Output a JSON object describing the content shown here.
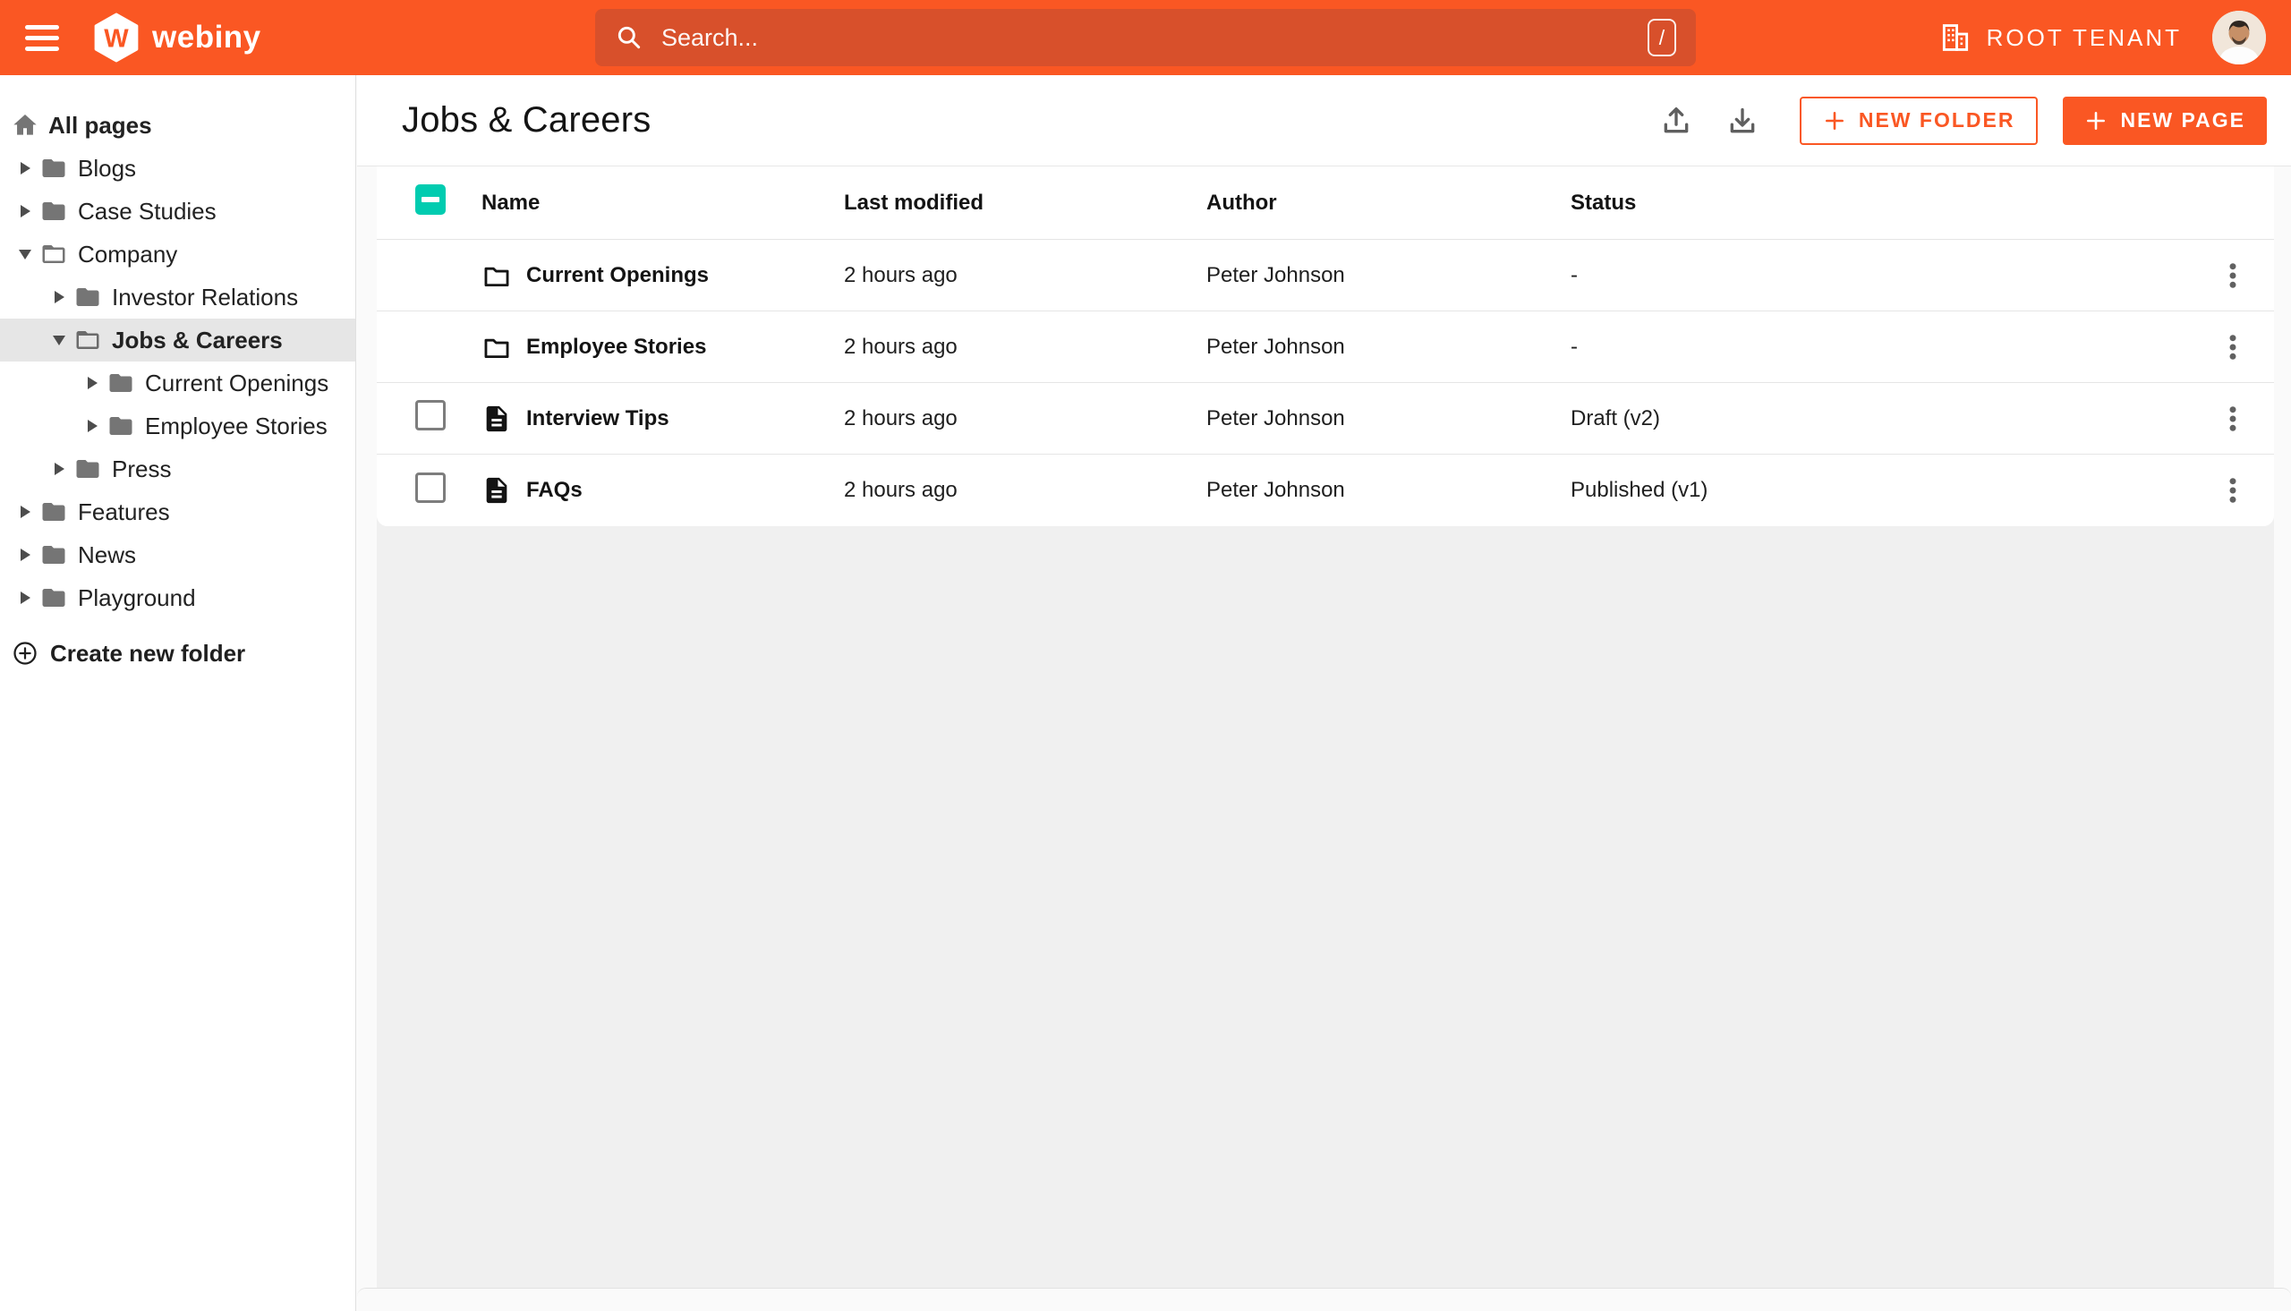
{
  "topbar": {
    "logo_text": "webiny",
    "search": {
      "placeholder": "Search...",
      "shortcut_key": "/"
    },
    "tenant_label": "ROOT TENANT"
  },
  "sidebar": {
    "root_label": "All pages",
    "items": [
      {
        "label": "Blogs",
        "level": 1,
        "state": "collapsed"
      },
      {
        "label": "Case Studies",
        "level": 1,
        "state": "collapsed"
      },
      {
        "label": "Company",
        "level": 1,
        "state": "expanded"
      },
      {
        "label": "Investor Relations",
        "level": 2,
        "state": "collapsed"
      },
      {
        "label": "Jobs & Careers",
        "level": 2,
        "state": "expanded",
        "selected": true
      },
      {
        "label": "Current Openings",
        "level": 3,
        "state": "collapsed"
      },
      {
        "label": "Employee Stories",
        "level": 3,
        "state": "collapsed"
      },
      {
        "label": "Press",
        "level": 2,
        "state": "collapsed"
      },
      {
        "label": "Features",
        "level": 1,
        "state": "collapsed"
      },
      {
        "label": "News",
        "level": 1,
        "state": "collapsed"
      },
      {
        "label": "Playground",
        "level": 1,
        "state": "collapsed"
      }
    ],
    "create_folder_label": "Create new folder"
  },
  "page": {
    "title": "Jobs & Careers",
    "actions": {
      "new_folder": "NEW FOLDER",
      "new_page": "NEW PAGE"
    }
  },
  "table": {
    "select_all_state": "indeterminate",
    "columns": [
      "Name",
      "Last modified",
      "Author",
      "Status"
    ],
    "rows": [
      {
        "type": "folder",
        "name": "Current Openings",
        "modified": "2 hours ago",
        "author": "Peter Johnson",
        "status": "-"
      },
      {
        "type": "folder",
        "name": "Employee Stories",
        "modified": "2 hours ago",
        "author": "Peter Johnson",
        "status": "-"
      },
      {
        "type": "page",
        "name": "Interview Tips",
        "modified": "2 hours ago",
        "author": "Peter Johnson",
        "status": "Draft (v2)"
      },
      {
        "type": "page",
        "name": "FAQs",
        "modified": "2 hours ago",
        "author": "Peter Johnson",
        "status": "Published (v1)"
      }
    ]
  },
  "colors": {
    "primary": "#fa5723",
    "search_field": "#d8502b",
    "select_teal": "#00ccb0"
  }
}
